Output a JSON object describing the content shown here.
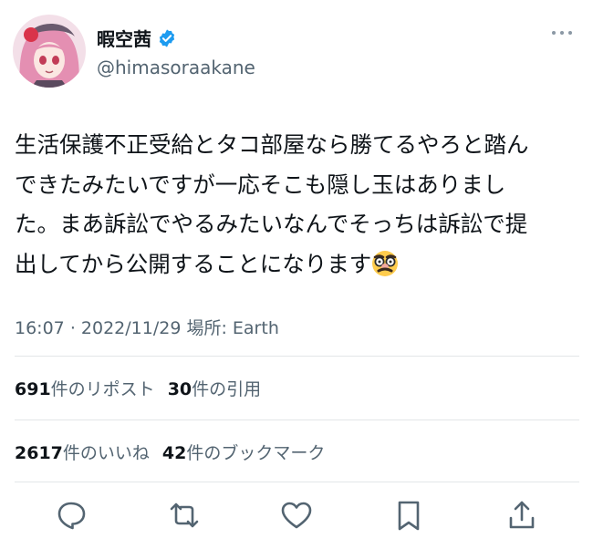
{
  "user": {
    "display_name": "暇空茜",
    "handle": "@himasoraakane",
    "verified": true,
    "verified_color": "#1d9bf0"
  },
  "tweet": {
    "text": "生活保護不正受給とタコ部屋なら勝てるやろと踏ん\nできたみたいですが一応そこも隠し玉はありまし\nた。まあ訴訟でやるみたいなんでそっちは訴訟で提\n出してから公開することになります",
    "emoji": "glasses-nose-disguise-emoji"
  },
  "meta": {
    "time": "16:07",
    "separator": "·",
    "date": "2022/11/29",
    "location_label": "場所: Earth"
  },
  "stats": {
    "reposts_count": "691",
    "reposts_label": "件のリポスト",
    "quotes_count": "30",
    "quotes_label": "件の引用",
    "likes_count": "2617",
    "likes_label": "件のいいね",
    "bookmarks_count": "42",
    "bookmarks_label": "件のブックマーク"
  },
  "actions": [
    "reply-icon",
    "repost-icon",
    "like-icon",
    "bookmark-icon",
    "share-icon"
  ]
}
